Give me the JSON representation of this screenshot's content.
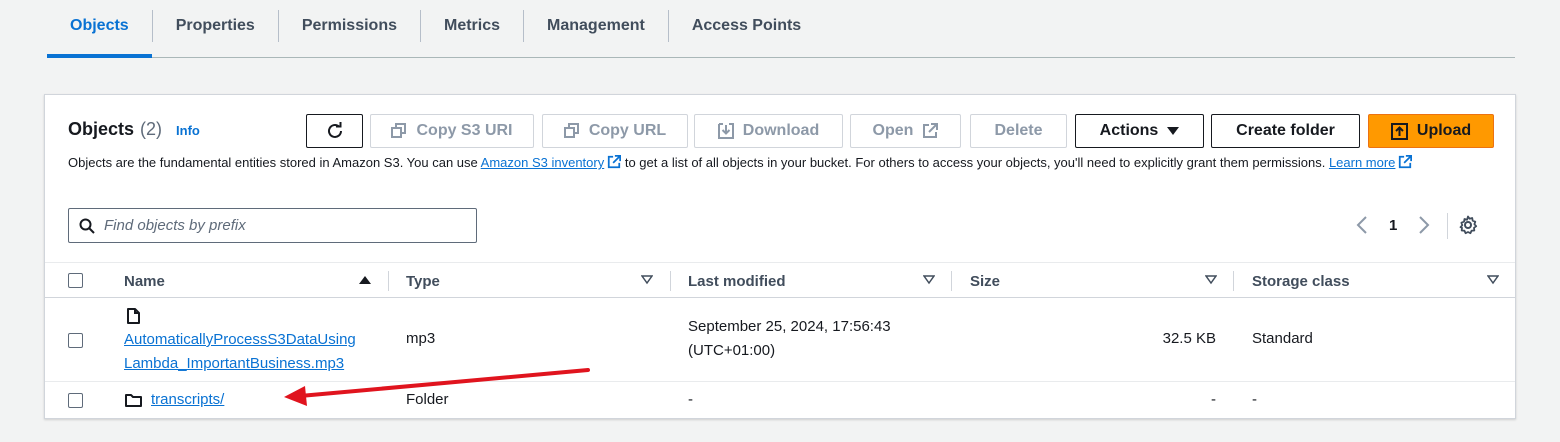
{
  "tabs": [
    {
      "label": "Objects",
      "active": true
    },
    {
      "label": "Properties"
    },
    {
      "label": "Permissions"
    },
    {
      "label": "Metrics"
    },
    {
      "label": "Management"
    },
    {
      "label": "Access Points"
    }
  ],
  "panel": {
    "title": "Objects",
    "count": "(2)",
    "info": "Info",
    "description_prefix": "Objects are the fundamental entities stored in Amazon S3. You can use ",
    "inventory_link": "Amazon S3 inventory",
    "description_mid": " to get a list of all objects in your bucket. For others to access your objects, you'll need to explicitly grant them permissions. ",
    "learn_more": "Learn more"
  },
  "toolbar": {
    "copy_s3_uri": "Copy S3 URI",
    "copy_url": "Copy URL",
    "download": "Download",
    "open": "Open",
    "delete": "Delete",
    "actions": "Actions",
    "create_folder": "Create folder",
    "upload": "Upload"
  },
  "search": {
    "placeholder": "Find objects by prefix"
  },
  "pagination": {
    "page": "1"
  },
  "table": {
    "columns": [
      "Name",
      "Type",
      "Last modified",
      "Size",
      "Storage class"
    ],
    "rows": [
      {
        "icon": "file-icon",
        "name_line1": "AutomaticallyProcessS3DataUsing",
        "name_line2": "Lambda_ImportantBusiness.mp3",
        "type": "mp3",
        "modified_line1": "September 25, 2024, 17:56:43",
        "modified_line2": "(UTC+01:00)",
        "size": "32.5 KB",
        "storage": "Standard"
      },
      {
        "icon": "folder-icon",
        "name": "transcripts/",
        "type": "Folder",
        "modified": "-",
        "size": "-",
        "storage": "-"
      }
    ]
  },
  "colors": {
    "accent": "#0972d3",
    "upload": "#ff9900",
    "annotation": "#e0141e"
  }
}
